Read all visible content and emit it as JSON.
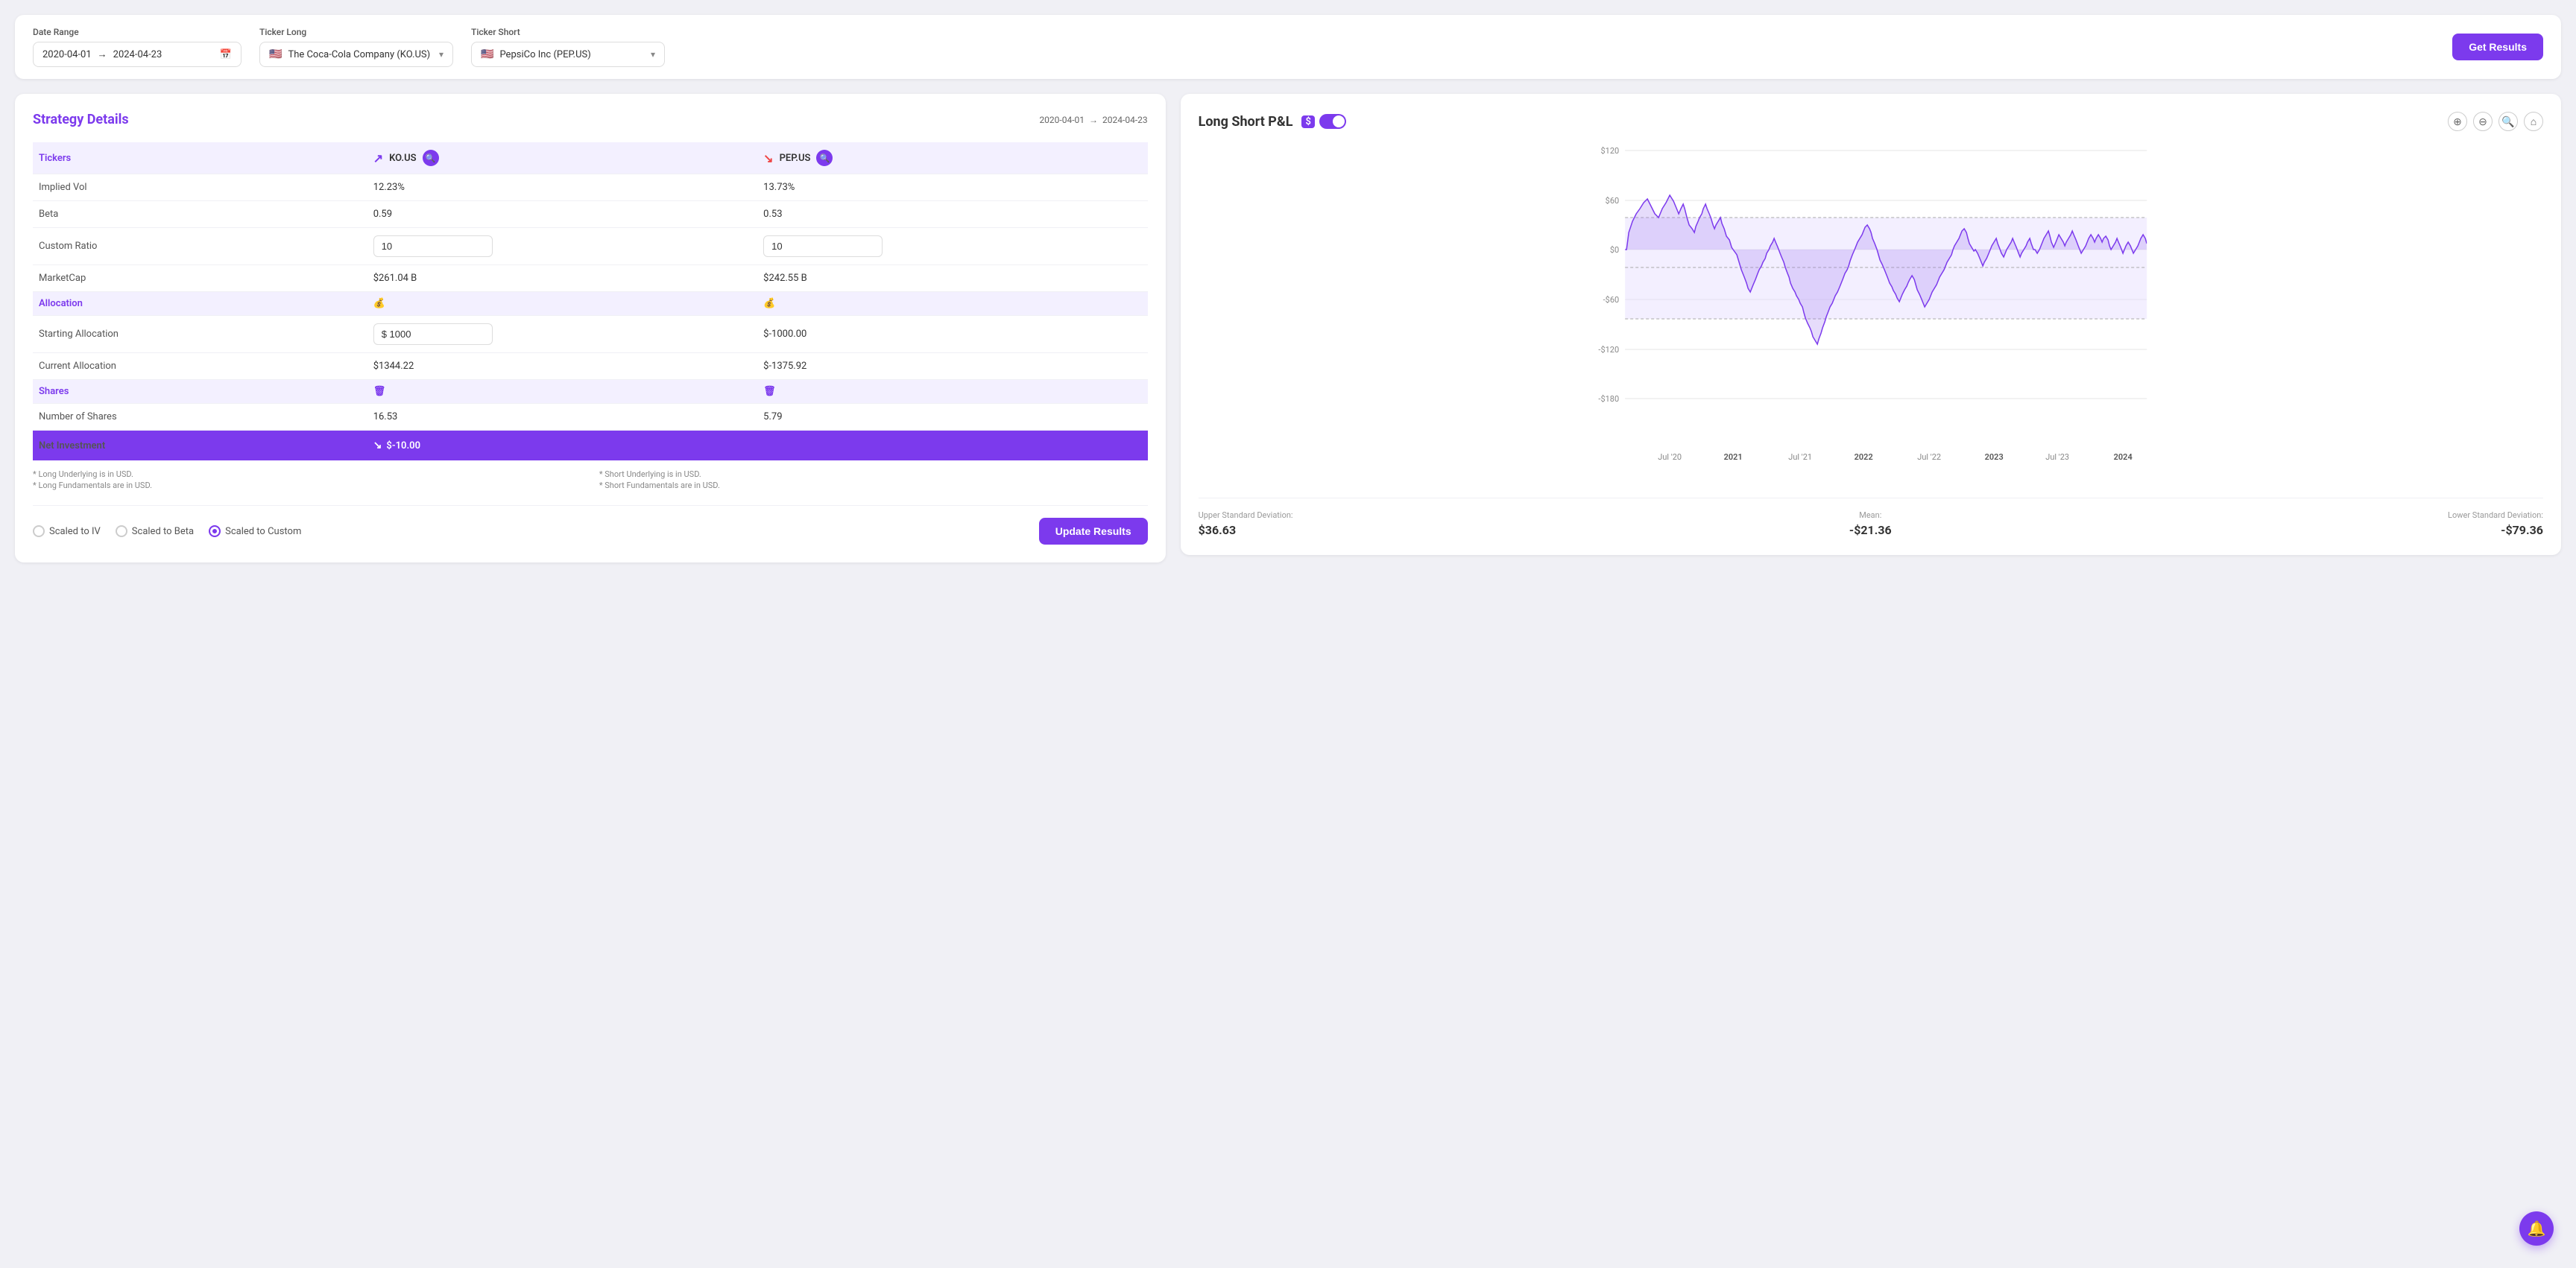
{
  "topBar": {
    "dateRangeLabel": "Date Range",
    "dateStart": "2020-04-01",
    "dateEnd": "2024-04-23",
    "tickerLongLabel": "Ticker Long",
    "tickerLongValue": "The Coca-Cola Company (KO.US)",
    "tickerShortLabel": "Ticker Short",
    "tickerShortValue": "PepsiCo Inc (PEP.US)",
    "getResultsLabel": "Get Results"
  },
  "strategyDetails": {
    "title": "Strategy Details",
    "dateStart": "2020-04-01",
    "dateEnd": "2024-04-23",
    "arrowLabel": "→",
    "tickers": {
      "label": "Tickers",
      "long": "KO.US",
      "short": "PEP.US"
    },
    "rows": [
      {
        "label": "Implied Vol",
        "longVal": "12.23%",
        "shortVal": "13.73%"
      },
      {
        "label": "Beta",
        "longVal": "0.59",
        "shortVal": "0.53"
      },
      {
        "label": "Custom Ratio",
        "longVal": "10",
        "shortVal": "10",
        "isInput": true
      },
      {
        "label": "MarketCap",
        "longVal": "$261.04 B",
        "shortVal": "$242.55 B"
      },
      {
        "label": "Allocation",
        "longVal": "💰",
        "shortVal": "💰",
        "isSection": true
      },
      {
        "label": "Starting Allocation",
        "longVal": "$ 1000",
        "shortVal": "$-1000.00",
        "longIsInput": true
      },
      {
        "label": "Current Allocation",
        "longVal": "$1344.22",
        "shortVal": "$-1375.92"
      },
      {
        "label": "Shares",
        "longVal": "🗑",
        "shortVal": "🗑",
        "isSection": true
      },
      {
        "label": "Number of Shares",
        "longVal": "16.53",
        "shortVal": "5.79"
      }
    ],
    "netInvestment": {
      "label": "Net Investment",
      "value": "$-10.00"
    },
    "footnotes": [
      "* Long Underlying is in USD.",
      "* Short Underlying is in USD.",
      "* Long Fundamentals are in USD.",
      "* Short Fundamentals are in USD."
    ],
    "radioOptions": [
      {
        "label": "Scaled to IV",
        "active": false
      },
      {
        "label": "Scaled to Beta",
        "active": false
      },
      {
        "label": "Scaled to Custom",
        "active": true
      }
    ],
    "updateLabel": "Update Results"
  },
  "chart": {
    "title": "Long Short P&L",
    "toggleLabel": "$",
    "yAxisLabels": [
      "$120",
      "$60",
      "$0",
      "-$60",
      "-$120",
      "-$180"
    ],
    "xAxisLabels": [
      "Jul '20",
      "2021",
      "Jul '21",
      "2022",
      "Jul '22",
      "2023",
      "Jul '23",
      "2024"
    ],
    "stats": {
      "upperLabel": "Upper Standard Deviation:",
      "upperValue": "$36.63",
      "meanLabel": "Mean:",
      "meanValue": "-$21.36",
      "lowerLabel": "Lower Standard Deviation:",
      "lowerValue": "-$79.36"
    }
  }
}
